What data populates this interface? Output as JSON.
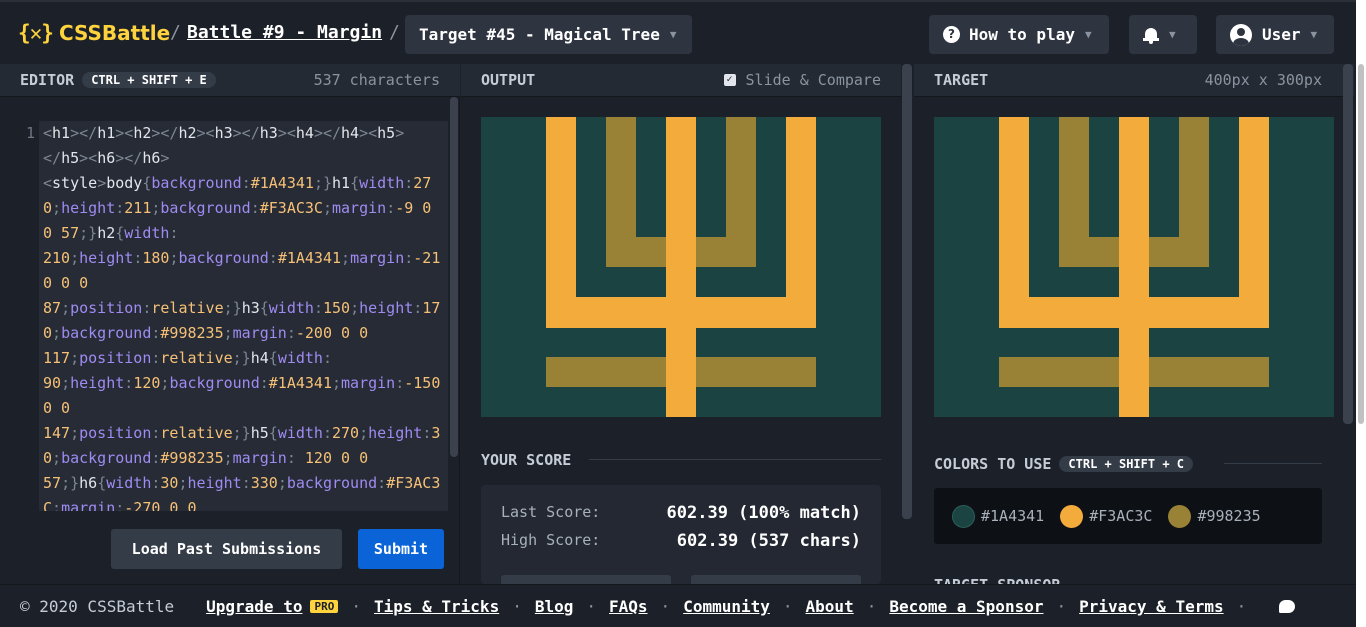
{
  "header": {
    "logo_mark": "{✕}",
    "logo_text": "CSSBattle",
    "separator": "/",
    "battle": "Battle #9 - Margin",
    "target_select": "Target #45 - Magical Tree",
    "how_to_play": "How to play",
    "user": "User"
  },
  "editor": {
    "title": "EDITOR",
    "shortcut": "CTRL + SHIFT + E",
    "char_count": "537 characters",
    "line_number": "1",
    "load_button": "Load Past Submissions",
    "submit_button": "Submit"
  },
  "output": {
    "title": "OUTPUT",
    "slide_compare": "Slide & Compare",
    "slide_compare_checked": true
  },
  "score": {
    "title": "YOUR SCORE",
    "last_label": "Last Score:",
    "last_value": "602.39 (100% match)",
    "high_label": "High Score:",
    "high_value": "602.39 (537 chars)"
  },
  "target": {
    "title": "TARGET",
    "size": "400px x 300px",
    "colors_title": "COLORS TO USE",
    "colors_shortcut": "CTRL + SHIFT + C",
    "colors": [
      "#1A4341",
      "#F3AC3C",
      "#998235"
    ],
    "sponsor_title": "TARGET SPONSOR"
  },
  "footer": {
    "copyright": "© 2020 CSSBattle",
    "upgrade": "Upgrade to",
    "pro_badge": "PRO",
    "tips": "Tips & Tricks",
    "blog": "Blog",
    "faqs": "FAQs",
    "community": "Community",
    "about": "About",
    "sponsor": "Become a Sponsor",
    "privacy": "Privacy & Terms",
    "sep": "·"
  }
}
